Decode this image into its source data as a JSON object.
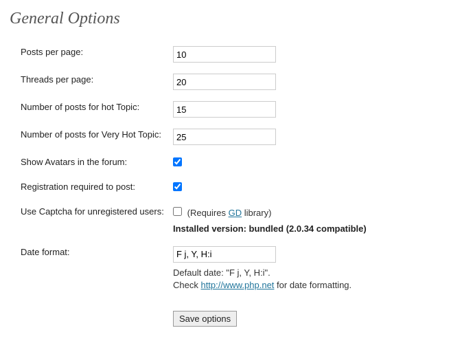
{
  "title": "General Options",
  "fields": {
    "posts_per_page": {
      "label": "Posts per page:",
      "value": "10"
    },
    "threads_per_page": {
      "label": "Threads per page:",
      "value": "20"
    },
    "hot_topic": {
      "label": "Number of posts for hot Topic:",
      "value": "15"
    },
    "very_hot_topic": {
      "label": "Number of posts for Very Hot Topic:",
      "value": "25"
    },
    "show_avatars": {
      "label": "Show Avatars in the forum:",
      "checked": true
    },
    "registration_required": {
      "label": "Registration required to post:",
      "checked": true
    },
    "use_captcha": {
      "label": "Use Captcha for unregistered users:",
      "checked": false,
      "requires_prefix": "(Requires ",
      "gd_link_text": "GD",
      "requires_suffix": " library)",
      "installed_text": "Installed version: bundled (2.0.34 compatible)"
    },
    "date_format": {
      "label": "Date format:",
      "value": "F j, Y, H:i",
      "default_text": "Default date: \"F j, Y, H:i\".",
      "check_prefix": "Check ",
      "php_link_text": "http://www.php.net",
      "check_suffix": " for date formatting."
    }
  },
  "submit": {
    "label": "Save options"
  }
}
